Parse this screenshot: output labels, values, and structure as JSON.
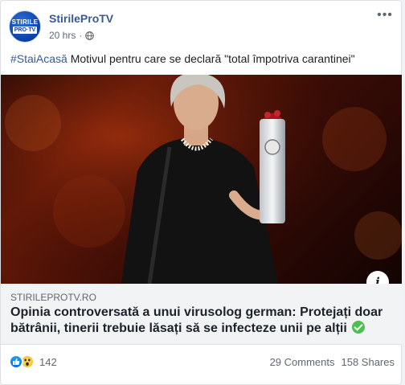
{
  "post": {
    "page_name": "StirileProTV",
    "time": "20 hrs",
    "audience_icon": "globe-icon",
    "hashtag": "#StaiAcasă",
    "text": " Motivul pentru care se declară \"total împotriva carantinei\""
  },
  "avatar": {
    "line1": "STIRILE",
    "line2": "PRO·TV"
  },
  "link": {
    "domain": "STIRILEPROTV.RO",
    "title": "Opinia controversată a unui virusolog german: Protejați doar bătrânii, tinerii trebuie lăsați să se infecteze unii pe alții",
    "info_label": "i"
  },
  "engagement": {
    "reactions": [
      "like-icon",
      "wow-icon"
    ],
    "reaction_count": "142",
    "comments": "29 Comments",
    "shares": "158 Shares"
  },
  "colors": {
    "link_blue": "#385898",
    "check_green": "#4bbf4f",
    "link_bg": "#f2f3f5"
  }
}
